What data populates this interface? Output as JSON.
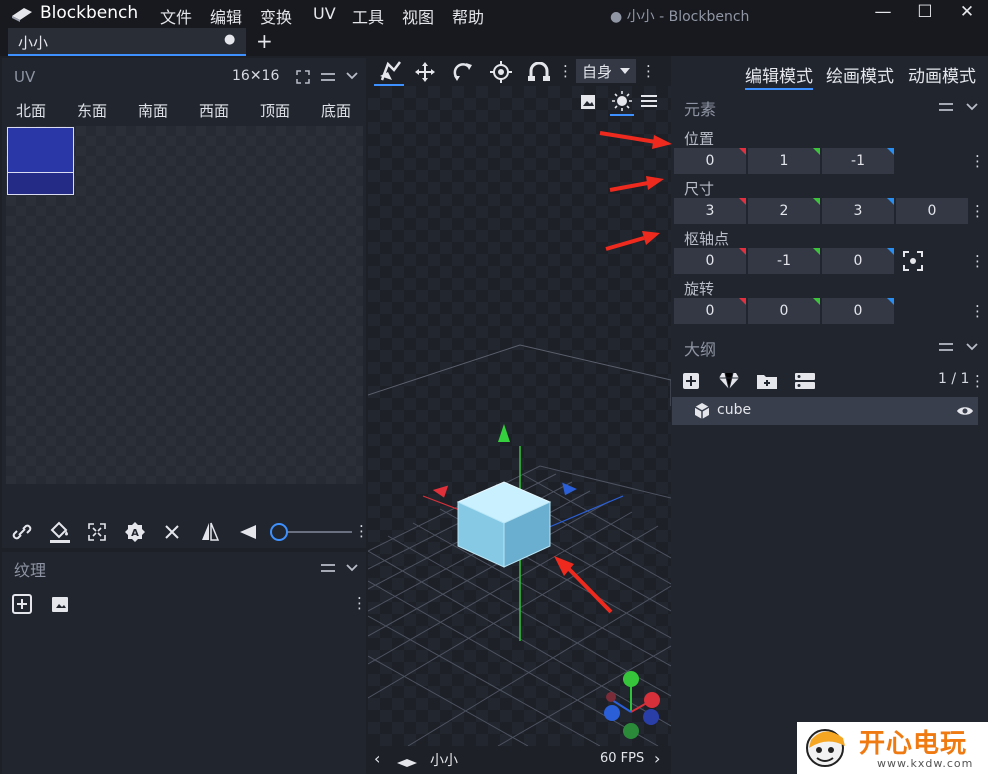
{
  "app": {
    "name": "Blockbench",
    "window_title": "● 小小 - Blockbench",
    "menu": [
      "文件",
      "编辑",
      "变换",
      "UV",
      "工具",
      "视图",
      "帮助"
    ],
    "window_controls": [
      "—",
      "☐",
      "✕"
    ]
  },
  "tab": {
    "label": "小小",
    "unsaved_dot": "●",
    "add": "+"
  },
  "uv_panel": {
    "title": "UV",
    "size": "16✕16",
    "faces": [
      "北面",
      "东面",
      "南面",
      "西面",
      "顶面",
      "底面"
    ]
  },
  "texture_panel": {
    "title": "纹理"
  },
  "viewport": {
    "space_select": "自身",
    "fps": "60 FPS",
    "model_name": "小小",
    "grid_color": "#5a5f6c",
    "cube_color": "#9fd8f0"
  },
  "modes": [
    "编辑模式",
    "绘画模式",
    "动画模式"
  ],
  "element_panel": {
    "title": "元素",
    "position": {
      "label": "位置",
      "values": [
        "0",
        "1",
        "-1"
      ]
    },
    "size": {
      "label": "尺寸",
      "values": [
        "3",
        "2",
        "3",
        "0"
      ]
    },
    "pivot": {
      "label": "枢轴点",
      "values": [
        "0",
        "-1",
        "0"
      ]
    },
    "rotation": {
      "label": "旋转",
      "values": [
        "0",
        "0",
        "0"
      ]
    }
  },
  "outliner": {
    "title": "大纲",
    "count": "1 / 1",
    "items": [
      {
        "name": "cube"
      }
    ]
  },
  "watermark": {
    "text": "开心电玩",
    "url": "www.kxdw.com"
  },
  "colors": {
    "accent": "#3e90ff",
    "annotation_arrow": "#ee2a1e"
  }
}
